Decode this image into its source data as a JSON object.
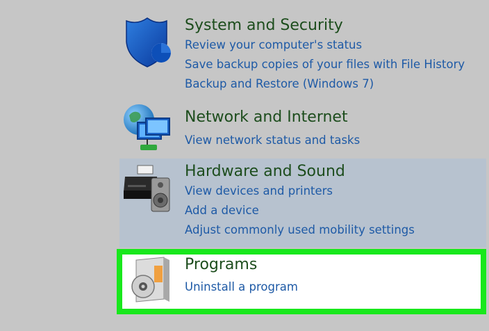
{
  "categories": [
    {
      "id": "system-and-security",
      "title": "System and Security",
      "icon": "shield-icon",
      "links": [
        "Review your computer's status",
        "Save backup copies of your files with File History",
        "Backup and Restore (Windows 7)"
      ]
    },
    {
      "id": "network-and-internet",
      "title": "Network and Internet",
      "icon": "network-globe-icon",
      "links": [
        "View network status and tasks"
      ]
    },
    {
      "id": "hardware-and-sound",
      "title": "Hardware and Sound",
      "icon": "printer-speaker-icon",
      "hovered": true,
      "links": [
        "View devices and printers",
        "Add a device",
        "Adjust commonly used mobility settings"
      ]
    },
    {
      "id": "programs",
      "title": "Programs",
      "icon": "programs-box-icon",
      "highlighted": true,
      "links": [
        "Uninstall a program"
      ]
    }
  ],
  "colors": {
    "background": "#c6c6c6",
    "title": "#1d4d1d",
    "link": "#1e5aa6",
    "hover_band": "#b7c2cf",
    "highlight_border": "#18e81c"
  }
}
